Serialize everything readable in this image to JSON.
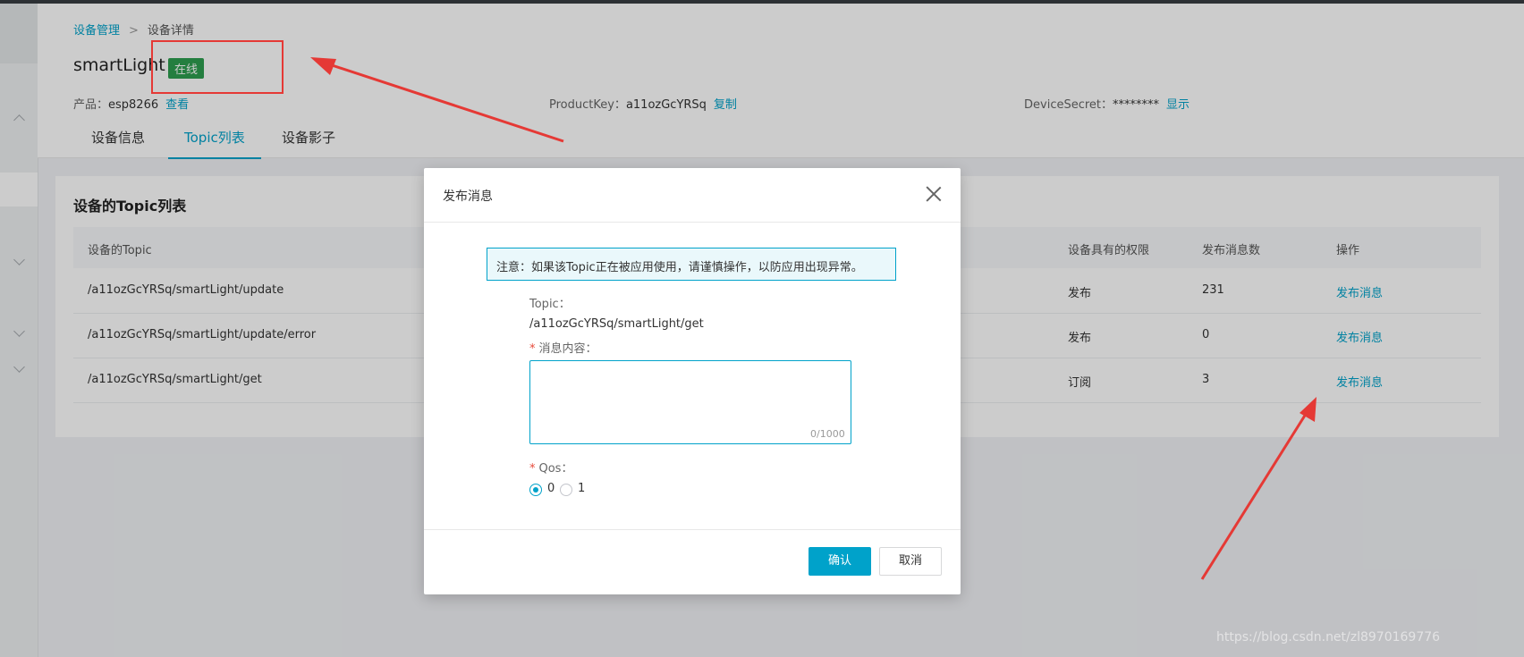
{
  "breadcrumb": {
    "root": "设备管理",
    "current": "设备详情"
  },
  "device": {
    "name": "smartLight",
    "status": "在线"
  },
  "meta": {
    "product_label": "产品：",
    "product_value": "esp8266",
    "product_link": "查看",
    "productkey_label": "ProductKey：",
    "productkey_value": "a11ozGcYRSq",
    "productkey_link": "复制",
    "secret_label": "DeviceSecret：",
    "secret_value": "********",
    "secret_link": "显示"
  },
  "tabs": [
    {
      "label": "设备信息",
      "active": false
    },
    {
      "label": "Topic列表",
      "active": true
    },
    {
      "label": "设备影子",
      "active": false
    }
  ],
  "topic_card": {
    "title": "设备的Topic列表",
    "columns": [
      "设备的Topic",
      "设备具有的权限",
      "发布消息数",
      "操作"
    ],
    "rows": [
      {
        "topic": "/a11ozGcYRSq/smartLight/update",
        "permission": "发布",
        "count": "231",
        "action": "发布消息"
      },
      {
        "topic": "/a11ozGcYRSq/smartLight/update/error",
        "permission": "发布",
        "count": "0",
        "action": "发布消息"
      },
      {
        "topic": "/a11ozGcYRSq/smartLight/get",
        "permission": "订阅",
        "count": "3",
        "action": "发布消息"
      }
    ]
  },
  "modal": {
    "title": "发布消息",
    "notice": "注意：如果该Topic正在被应用使用，请谨慎操作，以防应用出现异常。",
    "topic_label": "Topic：",
    "topic_value": "/a11ozGcYRSq/smartLight/get",
    "content_required": "*",
    "content_label": "消息内容：",
    "content_value": "",
    "content_counter": "0/1000",
    "qos_required": "*",
    "qos_label": "Qos：",
    "qos_options": [
      "0",
      "1"
    ],
    "qos_selected": "0",
    "confirm": "确认",
    "cancel": "取消"
  },
  "watermark": "https://blog.csdn.net/zl8970169776",
  "colors": {
    "accent": "#00a2ca",
    "online": "#2e9e4f",
    "annotation": "#e53935"
  }
}
